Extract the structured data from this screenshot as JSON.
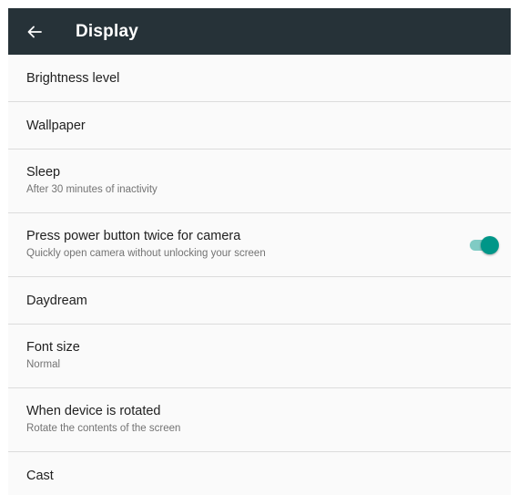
{
  "header": {
    "title": "Display",
    "background": "#263238",
    "back_icon": "arrow-back-icon"
  },
  "settings": {
    "brightness": {
      "title": "Brightness level"
    },
    "wallpaper": {
      "title": "Wallpaper"
    },
    "sleep": {
      "title": "Sleep",
      "summary": "After 30 minutes of inactivity"
    },
    "camera_gesture": {
      "title": "Press power button twice for camera",
      "summary": "Quickly open camera without unlocking your screen",
      "enabled": true
    },
    "daydream": {
      "title": "Daydream"
    },
    "font_size": {
      "title": "Font size",
      "summary": "Normal"
    },
    "rotation": {
      "title": "When device is rotated",
      "summary": "Rotate the contents of the screen"
    },
    "cast": {
      "title": "Cast"
    }
  },
  "colors": {
    "accent": "#009688",
    "accent_track": "#80cbc4",
    "divider": "#dcdcdc"
  }
}
